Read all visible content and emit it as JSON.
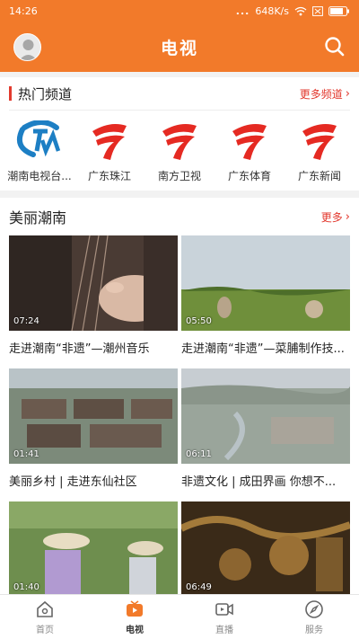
{
  "status_bar": {
    "time": "14:26",
    "dots": "...",
    "speed": "648K/s"
  },
  "header": {
    "title": "电视"
  },
  "hot_channels": {
    "title": "热门频道",
    "more_label": "更多频道",
    "items": [
      {
        "name": "潮南电视台..."
      },
      {
        "name": "广东珠江"
      },
      {
        "name": "南方卫视"
      },
      {
        "name": "广东体育"
      },
      {
        "name": "广东新闻"
      }
    ]
  },
  "section": {
    "title": "美丽潮南",
    "more_label": "更多",
    "videos": [
      {
        "title": "走进潮南“非遗”—潮州音乐",
        "duration": "07:24"
      },
      {
        "title": "走进潮南“非遗”—菜脯制作技...",
        "duration": "05:50"
      },
      {
        "title": "美丽乡村 | 走进东仙社区",
        "duration": "01:41"
      },
      {
        "title": "非遗文化 | 成田界画 你想不...",
        "duration": "06:11"
      },
      {
        "title": "",
        "duration": "01:40"
      },
      {
        "title": "",
        "duration": "06:49"
      }
    ]
  },
  "tabbar": {
    "items": [
      {
        "label": "首页",
        "icon": "home-icon"
      },
      {
        "label": "电视",
        "icon": "tv-icon"
      },
      {
        "label": "直播",
        "icon": "live-camera-icon"
      },
      {
        "label": "服务",
        "icon": "compass-icon"
      }
    ],
    "active_index": 1
  },
  "colors": {
    "brand": "#f27a2a",
    "accent_red": "#e2372c"
  }
}
